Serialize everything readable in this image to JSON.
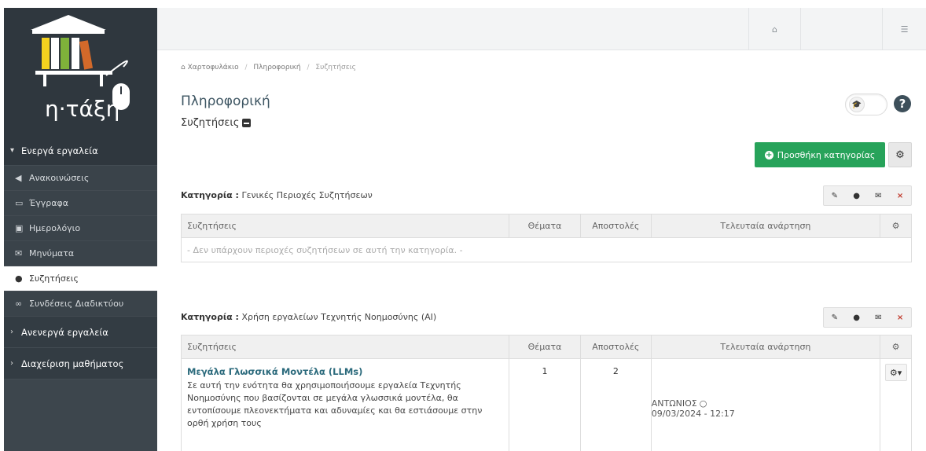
{
  "logo": {
    "text": "η·τάξη"
  },
  "sidebar": {
    "active_tools_label": "Ενεργά εργαλεία",
    "items": [
      {
        "label": "Ανακοινώσεις",
        "icon": "megaphone-icon"
      },
      {
        "label": "Έγγραφα",
        "icon": "folder-icon"
      },
      {
        "label": "Ημερολόγιο",
        "icon": "calendar-icon"
      },
      {
        "label": "Μηνύματα",
        "icon": "envelope-icon"
      },
      {
        "label": "Συζητήσεις",
        "icon": "comments-icon",
        "active": true
      },
      {
        "label": "Συνδέσεις Διαδικτύου",
        "icon": "link-icon"
      }
    ],
    "inactive_tools_label": "Ανενεργά εργαλεία",
    "course_admin_label": "Διαχείριση μαθήματος"
  },
  "topbar": {
    "home_icon": "home-icon",
    "settings_icon": "sliders-icon"
  },
  "breadcrumb": {
    "home": "Χαρτοφυλάκιο",
    "course": "Πληροφορική",
    "current": "Συζητήσεις"
  },
  "page": {
    "title": "Πληροφορική",
    "subtitle": "Συζητήσεις"
  },
  "buttons": {
    "add_category": "Προσθήκη κατηγορίας"
  },
  "table_headers": {
    "forums": "Συζητήσεις",
    "topics": "Θέματα",
    "posts": "Αποστολές",
    "last_post": "Τελευταία ανάρτηση"
  },
  "categories": [
    {
      "label": "Κατηγορία :",
      "name": "Γενικές Περιοχές Συζητήσεων",
      "empty_message": "- Δεν υπάρχουν περιοχές συζητήσεων σε αυτή την κατηγορία. -"
    },
    {
      "label": "Κατηγορία :",
      "name": "Χρήση εργαλείων Τεχνητής Νοημοσύνης (AI)",
      "forums": [
        {
          "name": "Μεγάλα Γλωσσικά Μοντέλα (LLMs)",
          "description": "Σε αυτή την ενότητα θα χρησιμοποιήσουμε εργαλεία Τεχνητής Νοημοσύνης που βασίζονται σε μεγάλα γλωσσικά μοντέλα, θα εντοπίσουμε πλεονεκτήματα και αδυναμίες και θα εστιάσουμε στην ορθή χρήση τους",
          "topics": "1",
          "posts": "2",
          "last_author": "ΑΝΤΩΝΙΟΣ",
          "last_date": "09/03/2024 - 12:17"
        }
      ]
    }
  ],
  "colors": {
    "sidebar_bg": "#3d464d",
    "accent_green": "#27a35a",
    "title_color": "#3d5562",
    "link_color": "#2b6a7c"
  }
}
